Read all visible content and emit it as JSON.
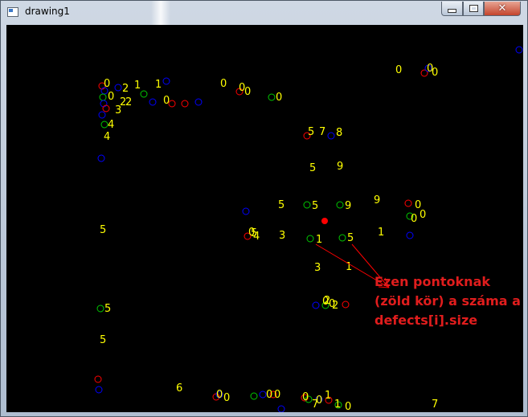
{
  "window": {
    "title": "drawing1",
    "controls": {
      "minimize_icon": "minimize-icon",
      "maximize_icon": "maximize-icon",
      "close_icon": "close-icon"
    }
  },
  "canvas": {
    "background": "#000000",
    "colors": {
      "label": "#ffff00",
      "green_circle": "#00c800",
      "blue_circle": "#0000ff",
      "red_circle": "#ff0000",
      "center_point": "#ff0000",
      "arrow": "#ff0000"
    },
    "labels": [
      "0",
      "2",
      "1",
      "1",
      "0",
      "0",
      "0",
      "0",
      "0",
      "0",
      "0",
      "0",
      "2",
      "2",
      "0",
      "3",
      "4",
      "4",
      "5",
      "7",
      "5",
      "8",
      "5",
      "9",
      "5",
      "5",
      "9",
      "9",
      "0",
      "0",
      "1",
      "0",
      "0",
      "5",
      "4",
      "3",
      "3",
      "1",
      "1",
      "5",
      "5",
      "5",
      "0",
      "0",
      "2",
      "2",
      "6",
      "0",
      "0",
      "0",
      "0",
      "1",
      "0",
      "0",
      "7",
      "7",
      "1",
      "0"
    ]
  },
  "annotation": {
    "lines": [
      "Ezen pontoknak",
      "(zöld kör) a száma a",
      "defects[i].size"
    ],
    "color": "#e01d1d"
  }
}
